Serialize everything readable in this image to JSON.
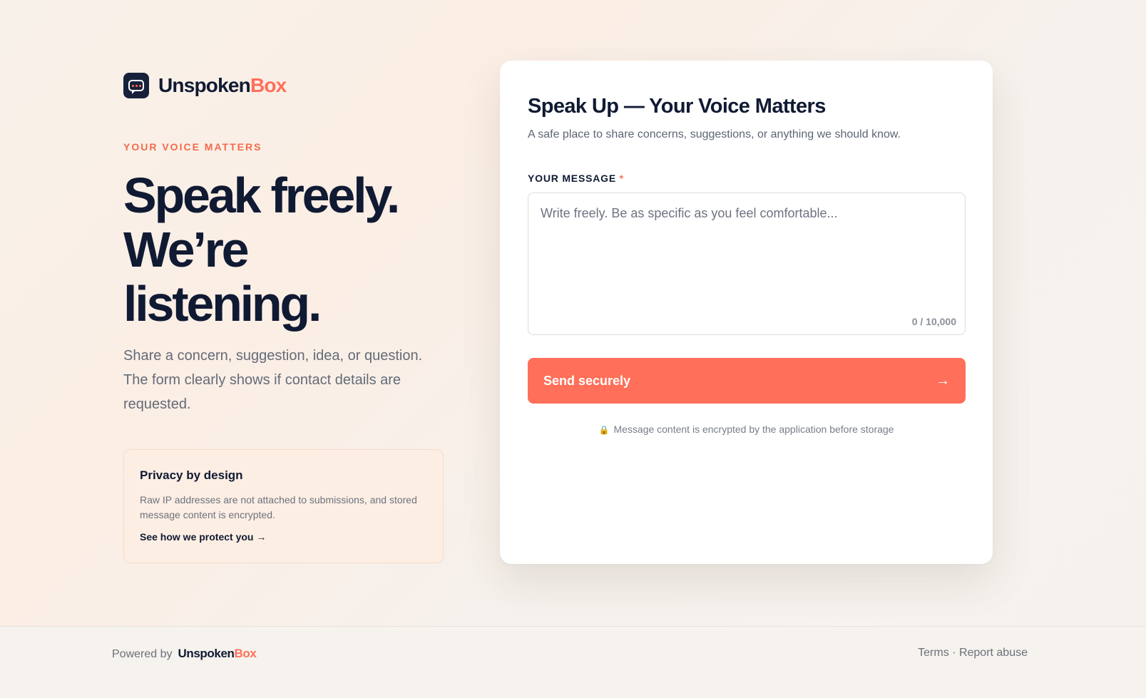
{
  "brand": {
    "name_main": "Unspoken",
    "name_accent": "Box",
    "accent_color": "#ff6f59",
    "dark_color": "#101a33",
    "logo_icon": "chat-bubble-icon"
  },
  "hero": {
    "eyebrow": "YOUR VOICE MATTERS",
    "headline_line1": "Speak freely.",
    "headline_line2": "We’re",
    "headline_line3": "listening.",
    "lede": "Share a concern, suggestion, idea, or question. The form clearly shows if contact details are requested."
  },
  "privacy": {
    "title": "Privacy by design",
    "body": "Raw IP addresses are not attached to submissions, and stored message content is encrypted.",
    "link": "See how we protect you →"
  },
  "form": {
    "title": "Speak Up — Your Voice Matters",
    "subtitle": "A safe place to share concerns, suggestions, or anything we should know.",
    "message_label": "YOUR MESSAGE",
    "required_mark": "*",
    "message_placeholder": "Write freely. Be as specific as you feel comfortable...",
    "message_value": "",
    "counter": "0 / 10,000",
    "submit_label": "Send securely",
    "submit_icon": "→",
    "encryption_note": "Message content is encrypted by the application before storage",
    "lock_icon": "🔒"
  },
  "footer": {
    "powered_by": "Powered by",
    "terms": "Terms",
    "separator": "·",
    "report": "Report abuse"
  }
}
